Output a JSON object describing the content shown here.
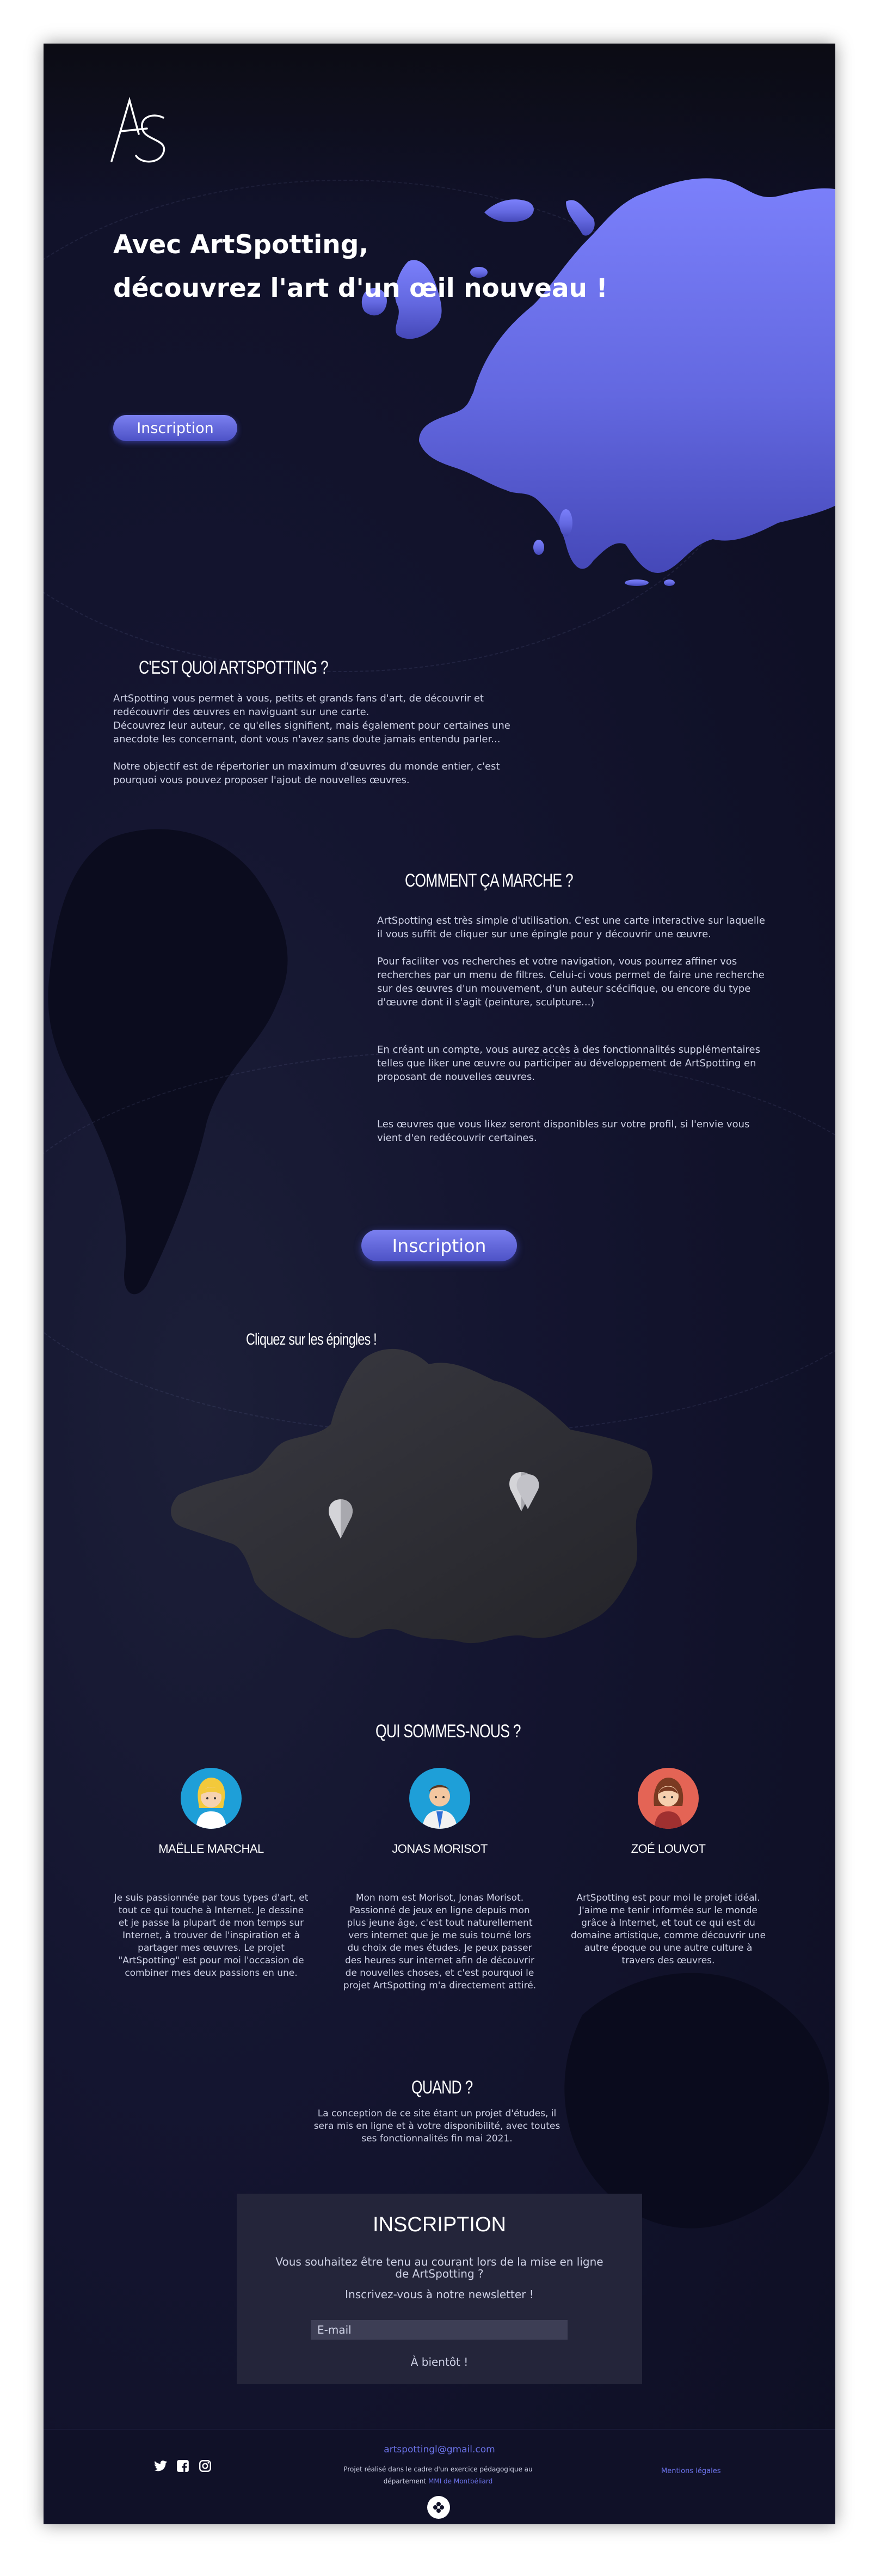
{
  "hero": {
    "logo_text": "AS",
    "title_line1": "Avec ArtSpotting,",
    "title_line2": "découvrez l'art d'un œil nouveau !",
    "signup_label": "Inscription"
  },
  "about": {
    "title": "C'EST QUOI ARTSPOTTING ?",
    "paragraphs": [
      "ArtSpotting vous permet à vous, petits et grands fans d'art, de découvrir et redécouvrir des œuvres en naviguant sur une carte.",
      "Découvrez leur auteur, ce qu'elles signifient, mais également pour certaines une anecdote les concernant, dont vous n'avez sans doute jamais entendu parler...",
      "Notre objectif est de répertorier un maximum d'œuvres du monde entier, c'est pourquoi vous pouvez proposer l'ajout de nouvelles œuvres."
    ]
  },
  "how": {
    "title": "COMMENT ÇA MARCHE ?",
    "paragraphs": [
      "ArtSpotting est très simple d'utilisation. C'est une carte interactive sur laquelle il vous suffit de cliquer sur une épingle pour y découvrir une œuvre.",
      "Pour faciliter vos recherches et votre navigation, vous pourrez affiner vos recherches par un menu de filtres. Celui-ci vous permet de faire une recherche sur des œuvres d'un mouvement, d'un auteur scécifique, ou encore du type d'œuvre dont il s'agit (peinture, sculpture...)",
      "En créant un compte, vous aurez accès à des fonctionnalités supplémentaires telles que liker une œuvre ou participer au développement de ArtSpotting en proposant de nouvelles œuvres.",
      "Les œuvres que vous likez seront disponibles sur votre profil, si l'envie vous vient d'en redécouvrir certaines."
    ],
    "signup_label": "Inscription"
  },
  "map": {
    "hint": "Cliquez sur les épingles !"
  },
  "team": {
    "title": "QUI SOMMES-NOUS ?",
    "members": [
      {
        "name": "MAËLLE MARCHAL",
        "bio": "Je suis passionnée par tous types d'art, et tout ce qui touche à Internet. Je dessine et je passe la plupart de mon temps sur Internet, à trouver de l'inspiration et à partager mes œuvres. Le projet \"ArtSpotting\" est pour moi l'occasion de combiner mes deux passions en une."
      },
      {
        "name": "JONAS MORISOT",
        "bio": "Mon nom est Morisot, Jonas Morisot. Passionné de jeux en ligne depuis mon plus jeune âge, c'est tout naturellement vers internet que je me suis tourné lors du choix de mes études. Je peux passer des heures sur internet afin de découvrir de nouvelles choses, et c'est pourquoi le projet ArtSpotting m'a directement attiré."
      },
      {
        "name": "ZOÉ LOUVOT",
        "bio": "ArtSpotting est pour moi le projet idéal. J'aime me tenir informée sur le monde grâce à Internet, et tout ce qui est du domaine artistique, comme découvrir une autre époque ou une autre culture à travers des œuvres."
      }
    ]
  },
  "when": {
    "title": "QUAND ?",
    "text": "La conception de ce site étant un projet d'études, il sera mis en ligne et à votre disponibilité, avec toutes ses fonctionnalités fin mai 2021."
  },
  "newsletter": {
    "title": "INSCRIPTION",
    "text1": "Vous souhaitez être tenu au courant lors de la mise en ligne de ArtSpotting ?",
    "text2": "Inscrivez-vous à notre newsletter !",
    "email_placeholder": "E-mail",
    "submit_label": "À bientôt !"
  },
  "footer": {
    "email": "artspottingl@gmail.com",
    "note_line1": "Projet réalisé dans le cadre d'un exercice pédagogique au",
    "note_line2_prefix": "département ",
    "note_link": "MMI de Montbéliard",
    "legal": "Mentions légales",
    "social_icons": [
      "twitter-icon",
      "facebook-icon",
      "instagram-icon"
    ]
  },
  "colors": {
    "accent": "#6b72e8",
    "europe": "#6f74f2",
    "background": "#101128",
    "france": "#2c2c34"
  }
}
